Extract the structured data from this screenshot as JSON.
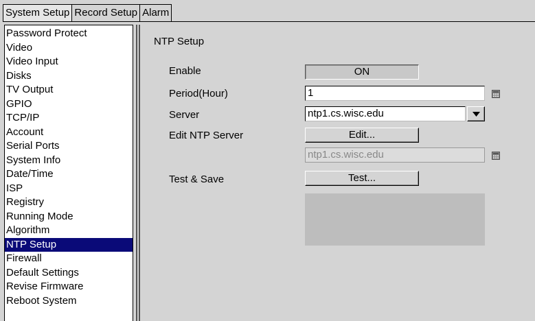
{
  "tabs": [
    {
      "label": "System Setup",
      "active": true
    },
    {
      "label": "Record Setup",
      "active": false
    },
    {
      "label": "Alarm",
      "active": false
    }
  ],
  "sidebar": {
    "items": [
      {
        "label": "Password Protect"
      },
      {
        "label": "Video"
      },
      {
        "label": "Video Input"
      },
      {
        "label": "Disks"
      },
      {
        "label": "TV Output"
      },
      {
        "label": "GPIO"
      },
      {
        "label": "TCP/IP"
      },
      {
        "label": "Account"
      },
      {
        "label": "Serial Ports"
      },
      {
        "label": "System Info"
      },
      {
        "label": "Date/Time"
      },
      {
        "label": "ISP"
      },
      {
        "label": "Registry"
      },
      {
        "label": "Running Mode"
      },
      {
        "label": "Algorithm"
      },
      {
        "label": "NTP Setup",
        "selected": true
      },
      {
        "label": "Firewall"
      },
      {
        "label": "Default Settings"
      },
      {
        "label": "Revise Firmware"
      },
      {
        "label": "Reboot System"
      }
    ],
    "selected_color": "#0a0a78"
  },
  "panel": {
    "title": "NTP Setup",
    "enable": {
      "label": "Enable",
      "value": "ON"
    },
    "period": {
      "label": "Period(Hour)",
      "value": "1",
      "icon": "calculator-icon"
    },
    "server": {
      "label": "Server",
      "value": "ntp1.cs.wisc.edu",
      "icon": "chevron-down-icon"
    },
    "edit_server": {
      "label": "Edit NTP Server",
      "button": "Edit...",
      "value": "ntp1.cs.wisc.edu",
      "icon": "calculator-icon"
    },
    "test_save": {
      "label": "Test & Save",
      "button": "Test..."
    }
  }
}
